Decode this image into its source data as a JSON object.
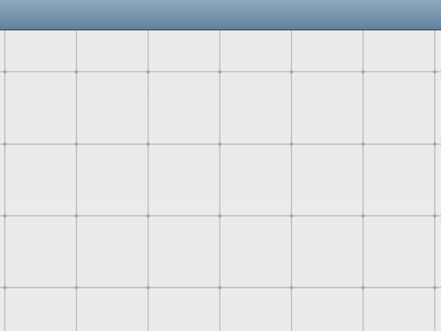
{
  "window": {
    "title": ""
  },
  "colors": {
    "title_bar_top": "#8ea7bb",
    "title_bar_bottom": "#5f7f9b",
    "canvas_background": "#ececec",
    "grid_line": "#b5b5b5",
    "grid_node": "#a8a8a8"
  },
  "canvas": {
    "grid_columns": 6,
    "grid_rows": 4,
    "icon": "grid-icon"
  }
}
